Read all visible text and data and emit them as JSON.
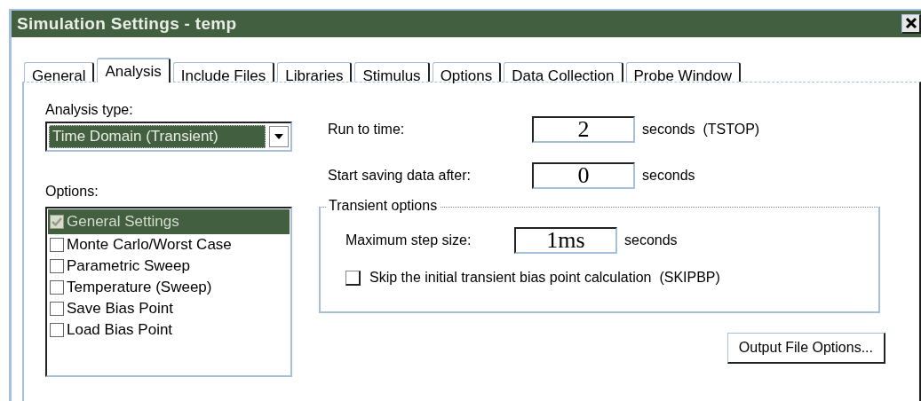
{
  "window": {
    "title": "Simulation Settings - temp"
  },
  "tabs": [
    {
      "label": "General",
      "selected": false
    },
    {
      "label": "Analysis",
      "selected": true
    },
    {
      "label": "Include Files",
      "selected": false
    },
    {
      "label": "Libraries",
      "selected": false
    },
    {
      "label": "Stimulus",
      "selected": false
    },
    {
      "label": "Options",
      "selected": false
    },
    {
      "label": "Data Collection",
      "selected": false
    },
    {
      "label": "Probe Window",
      "selected": false
    }
  ],
  "analysis_type": {
    "label": "Analysis type:",
    "value": "Time Domain (Transient)"
  },
  "options": {
    "label": "Options:",
    "items": [
      {
        "label": "General Settings",
        "checked": true,
        "selected": true
      },
      {
        "label": "Monte Carlo/Worst Case",
        "checked": false,
        "selected": false
      },
      {
        "label": "Parametric Sweep",
        "checked": false,
        "selected": false
      },
      {
        "label": "Temperature (Sweep)",
        "checked": false,
        "selected": false
      },
      {
        "label": "Save Bias Point",
        "checked": false,
        "selected": false
      },
      {
        "label": "Load Bias Point",
        "checked": false,
        "selected": false
      }
    ]
  },
  "run_to_time": {
    "label": "Run to time:",
    "value": "2",
    "unit": "seconds  (TSTOP)"
  },
  "start_saving": {
    "label": "Start saving data after:",
    "value": "0",
    "unit": "seconds"
  },
  "transient_options": {
    "title": "Transient options",
    "max_step": {
      "label": "Maximum step size:",
      "value": "1ms",
      "unit": "seconds"
    },
    "skip_bias": {
      "label": "Skip the initial transient bias point calculation  (SKIPBP)",
      "checked": false
    }
  },
  "buttons": [
    "Output File Options..."
  ]
}
